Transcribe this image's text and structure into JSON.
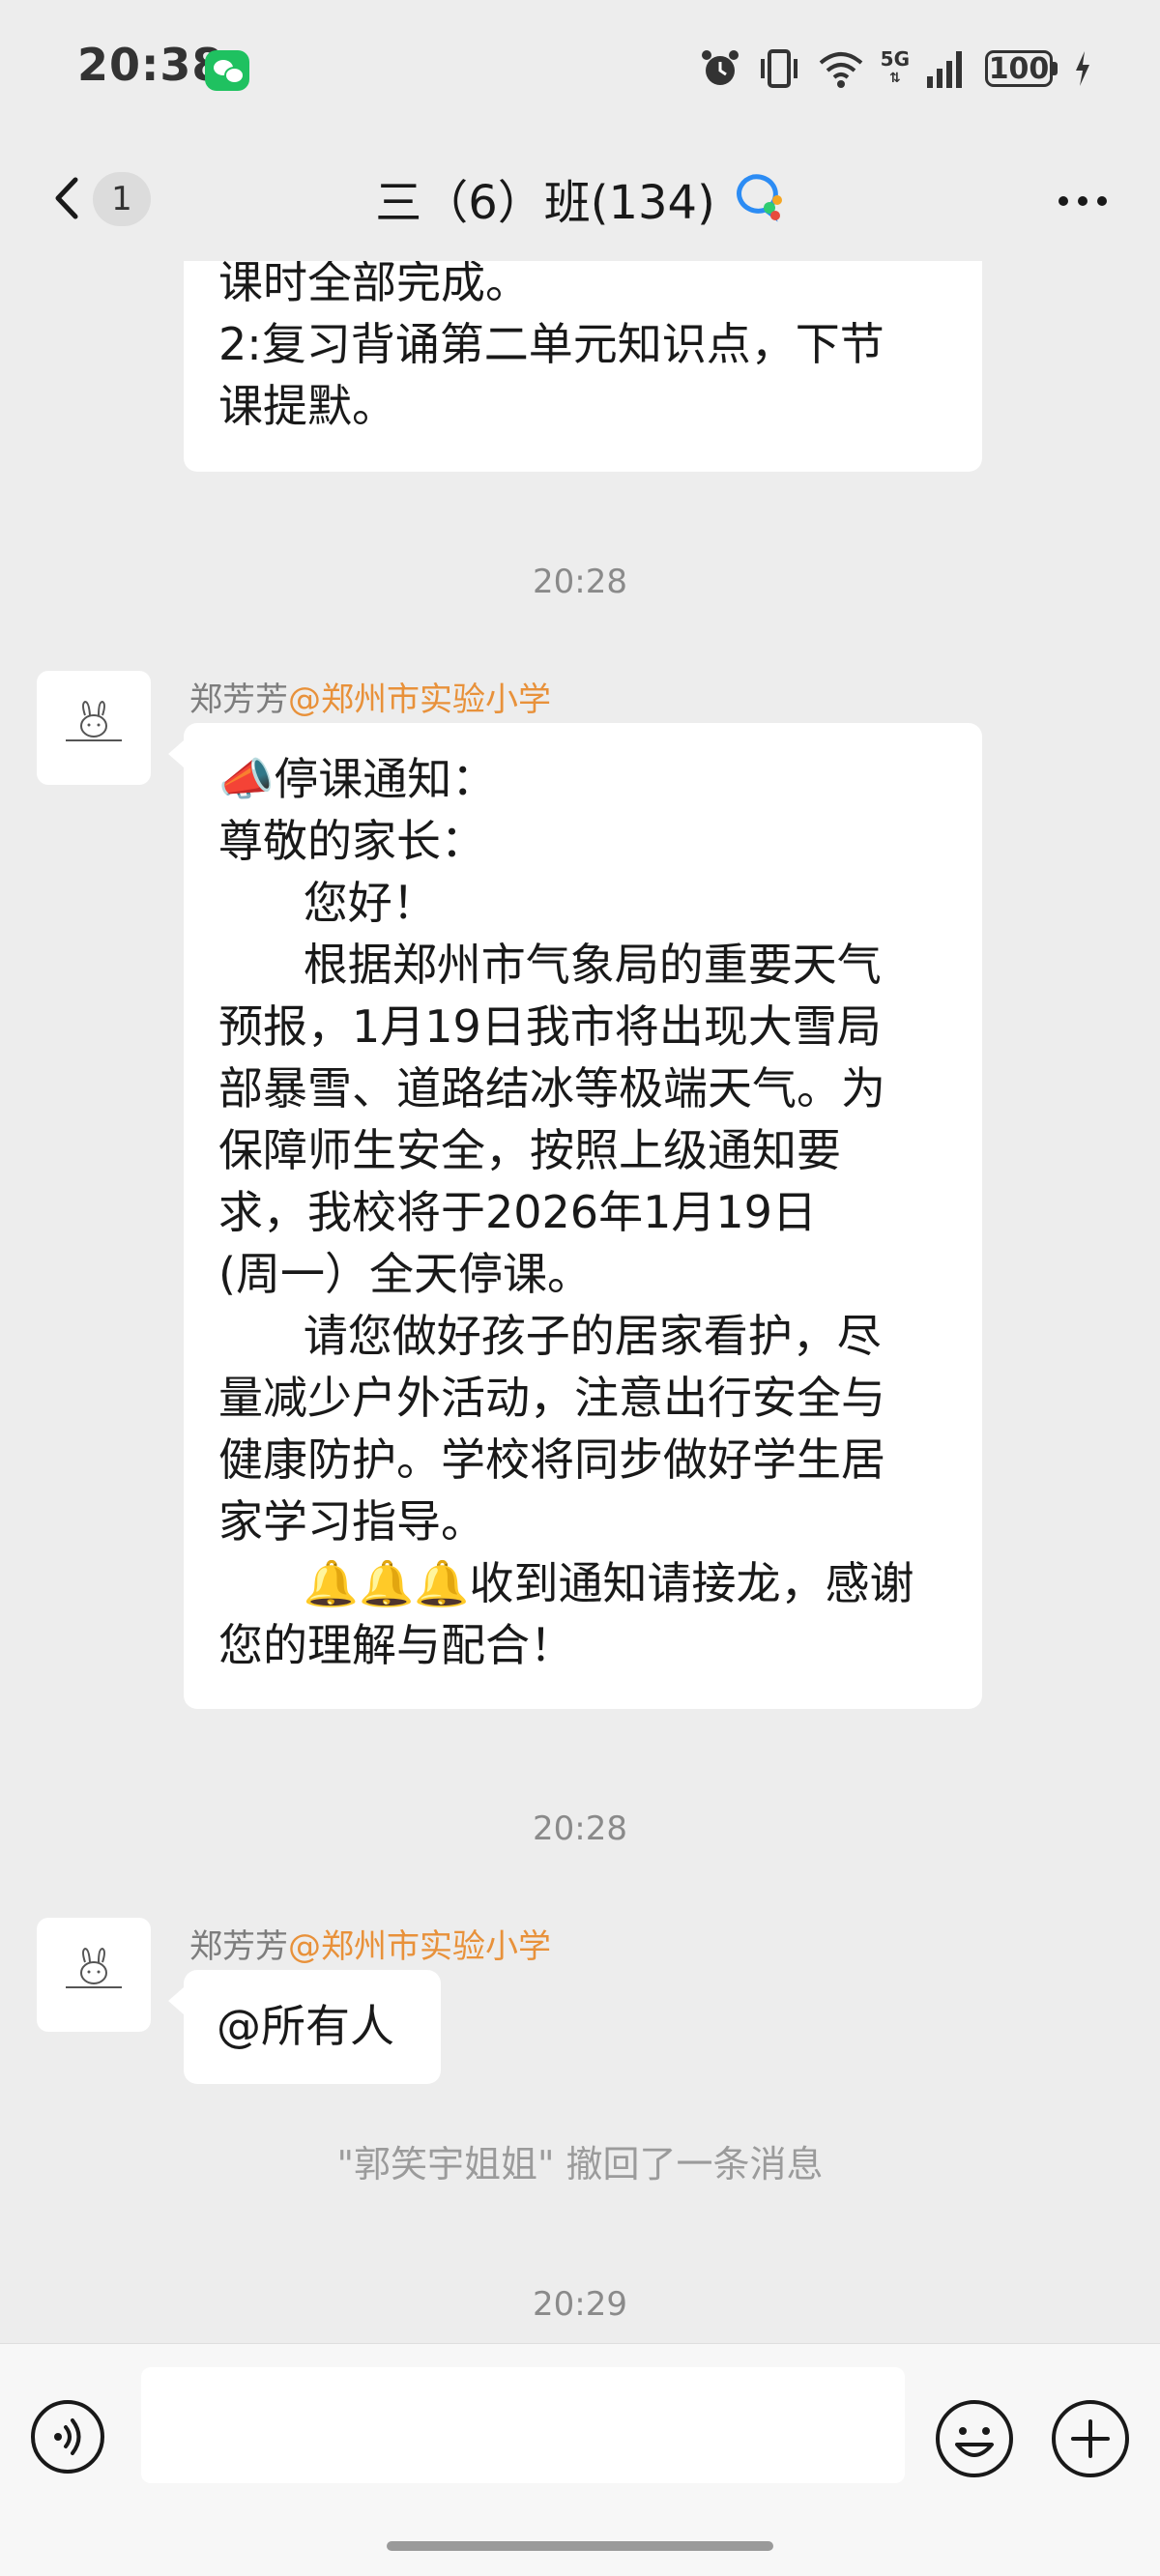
{
  "status_bar": {
    "time": "20:38",
    "network": "5G",
    "battery": "100"
  },
  "header": {
    "unread_count": "1",
    "title": "三（6）班(134)"
  },
  "messages": {
    "prev_lines": [
      "课时全部完成。",
      "2:复习背诵第二单元知识点，下节",
      "课提默。"
    ],
    "timestamp1": "20:28",
    "notice_sender": "郑芳芳",
    "notice_org": "@郑州市实验小学",
    "notice_lines": [
      "📣停课通知：",
      "尊敬的家长：",
      "      您好！",
      "      根据郑州市气象局的重要天气",
      "预报，1月19日我市将出现大雪局",
      "部暴雪、道路结冰等极端天气。为",
      "保障师生安全，按照上级通知要",
      "求，我校将于2026年1月19日",
      "(周一）全天停课。",
      "      请您做好孩子的居家看护，尽",
      "量减少户外活动，注意出行安全与",
      "健康防护。学校将同步做好学生居",
      "家学习指导。",
      "      🔔🔔🔔收到通知请接龙，感谢",
      "您的理解与配合！"
    ],
    "timestamp2": "20:28",
    "mention_sender": "郑芳芳",
    "mention_org": "@郑州市实验小学",
    "mention_text": "@所有人",
    "recall_text": "\"郭笑宇姐姐\" 撤回了一条消息",
    "timestamp3": "20:29"
  },
  "input": {
    "placeholder": ""
  },
  "icons": {
    "back": "chevron-left-icon",
    "group_badge": "group-chat-icon",
    "more": "more-dots-icon",
    "voice": "voice-icon",
    "emoji": "emoji-icon",
    "plus": "plus-icon",
    "avatar": "rabbit-avatar-icon"
  },
  "colors": {
    "background": "#ededed",
    "bubble": "#ffffff",
    "org_name": "#e8913a",
    "wechat_green": "#1fc160"
  }
}
